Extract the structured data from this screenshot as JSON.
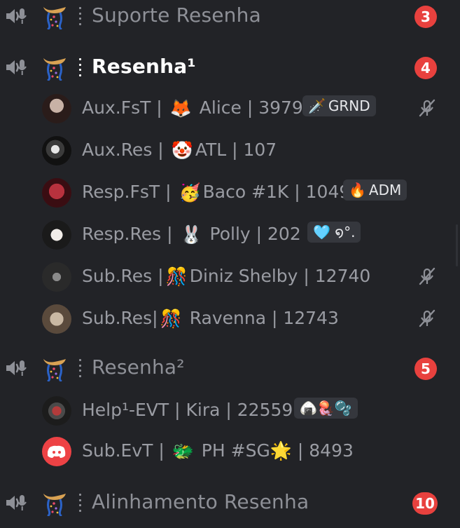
{
  "channels": [
    {
      "name": "Suporte Resenha",
      "badge": "3",
      "active": false
    },
    {
      "name": "Resenha¹",
      "badge": "4",
      "active": true
    },
    {
      "name": "Resenha²",
      "badge": "5",
      "active": false
    },
    {
      "name": "Alinhamento Resenha",
      "badge": "10",
      "active": false
    }
  ],
  "resenha1_users": [
    {
      "prefix": "Aux.FsT | ",
      "emoji": "🦊",
      "suffix": " Alice | 3979",
      "tag": "GRND",
      "tag_icon": "sword-icon",
      "muted": true
    },
    {
      "prefix": "Aux.Res | ",
      "emoji": "🤡",
      "suffix": "ATL  | 107",
      "tag": "",
      "muted": false
    },
    {
      "prefix": "Resp.FsT | ",
      "emoji": "🥳",
      "suffix": "Baco #1K | 1049",
      "tag": "ADM",
      "tag_icon": "fire-icon",
      "muted": false
    },
    {
      "prefix": "Resp.Res | ",
      "emoji": "🐰",
      "suffix": " Polly  | 202",
      "tag": "🩵 ໑°.",
      "muted": false
    },
    {
      "prefix": "Sub.Res |",
      "emoji": "🎊",
      "suffix": "Diniz Shelby | 12740",
      "tag": "",
      "muted": true
    },
    {
      "prefix": "Sub.Res|",
      "emoji": "🎊",
      "suffix": " Ravenna | 12743",
      "tag": "",
      "muted": true
    }
  ],
  "resenha2_users": [
    {
      "prefix": "Help¹-EVT | Kira | 22559",
      "emoji": "",
      "suffix": "",
      "tag": "🍙🪼🫧",
      "muted": false
    },
    {
      "prefix": "Sub.EvT | ",
      "emoji": "🐲",
      "suffix": " PH #SG🌟 | 8493",
      "tag": "",
      "muted": false
    }
  ],
  "colors": {
    "background": "#222327",
    "badge": "#e8413e",
    "text_muted": "#9a9ca3",
    "text_active": "#ffffff",
    "tag_bg": "#35373d"
  }
}
